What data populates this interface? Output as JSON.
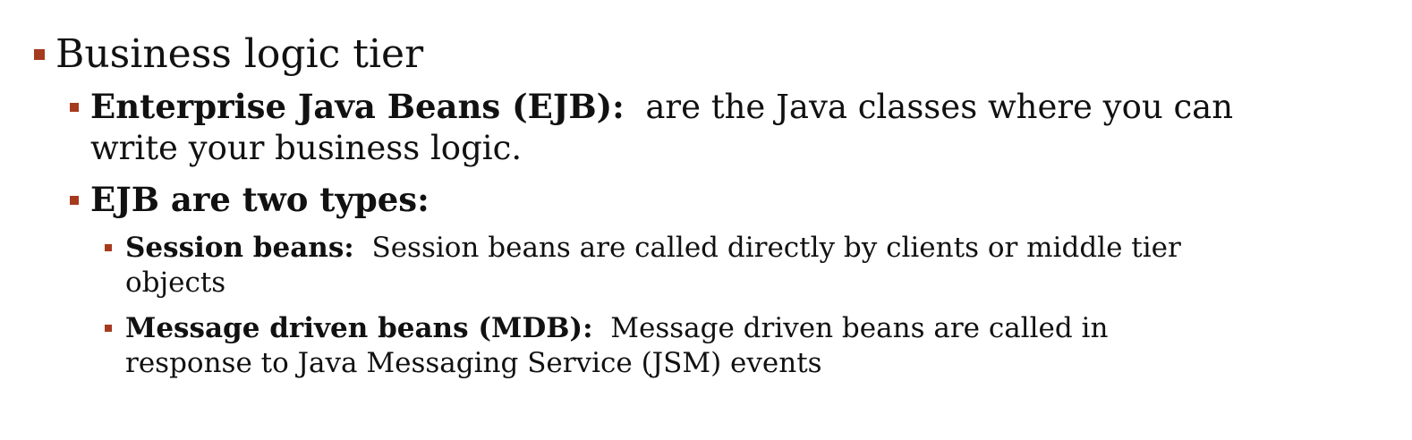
{
  "colors": {
    "bullet": "#a63a1e",
    "text": "#111111",
    "background": "#ffffff"
  },
  "slide": {
    "heading": "Business logic tier",
    "ejb_item": {
      "term": "Enterprise Java Beans (EJB):",
      "line1": "are the Java classes where you can",
      "line2": "write your business logic."
    },
    "types_item": {
      "label": "EJB are two types:"
    },
    "session_item": {
      "term": "Session beans:",
      "line1": "Session beans are called directly by clients or middle tier",
      "line2": "objects"
    },
    "mdb_item": {
      "term": "Message driven beans (MDB):",
      "line1": "Message driven beans are called in",
      "line2": "response to Java Messaging Service (JSM) events"
    }
  }
}
